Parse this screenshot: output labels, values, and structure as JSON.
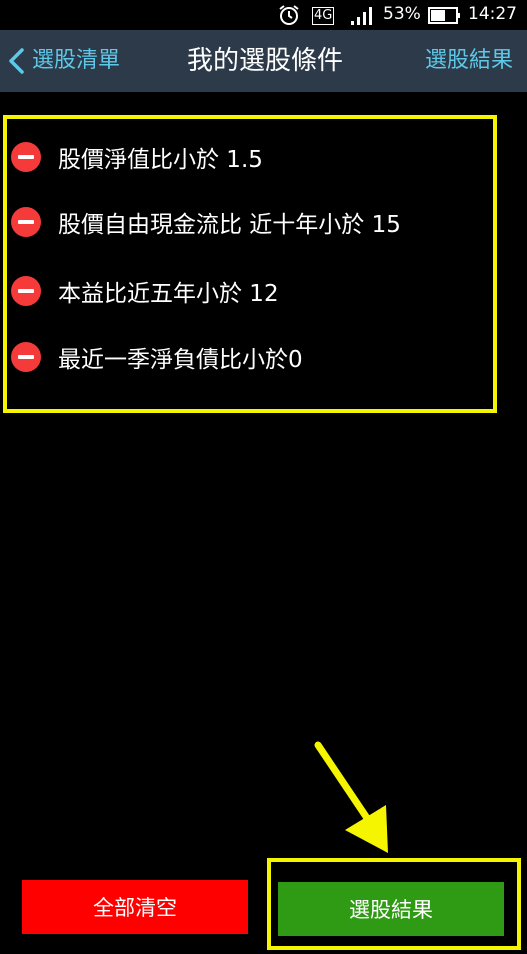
{
  "status_bar": {
    "network_label": "4G",
    "battery_text": "53%",
    "clock": "14:27"
  },
  "nav": {
    "back_label": "選股清單",
    "title": "我的選股條件",
    "results_link": "選股結果"
  },
  "conditions": [
    {
      "label": "股價淨值比小於 1.5"
    },
    {
      "label": "股價自由現金流比 近十年小於 15"
    },
    {
      "label": "本益比近五年小於 12"
    },
    {
      "label": "最近一季淨負債比小於0"
    }
  ],
  "actions": {
    "clear_all_label": "全部清空",
    "results_label": "選股結果"
  },
  "colors": {
    "nav_background": "#2c3a4a",
    "nav_accent": "#5ec8e8",
    "highlight": "#f5f500",
    "remove_red": "#f53a3a",
    "clear_button": "#ff0000",
    "results_button": "#2f9a13"
  },
  "icons": {
    "status": [
      "alarm-icon",
      "network-4g-icon",
      "signal-icon",
      "battery-icon"
    ],
    "nav_back": "chevron-left-icon",
    "condition_remove": "remove-minus-icon",
    "annotation": "yellow-arrow-icon"
  }
}
